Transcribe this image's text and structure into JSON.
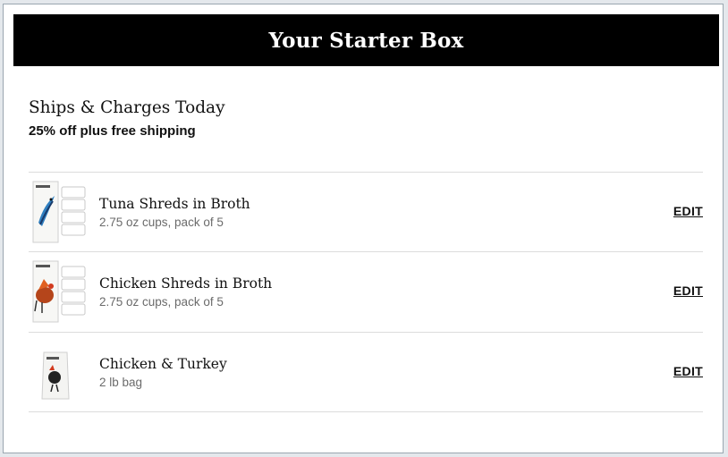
{
  "header": {
    "title": "Your Starter Box"
  },
  "section": {
    "title": "Ships & Charges Today",
    "subtitle": "25% off plus free shipping"
  },
  "items": [
    {
      "name": "Tuna Shreds in Broth",
      "desc": "2.75 oz cups, pack of 5",
      "edit_label": "EDIT",
      "image": "tuna-product-icon",
      "accent": "#2f7fc0"
    },
    {
      "name": "Chicken Shreds in Broth",
      "desc": "2.75 oz cups, pack of 5",
      "edit_label": "EDIT",
      "image": "chicken-product-icon",
      "accent": "#b5451b"
    },
    {
      "name": "Chicken & Turkey",
      "desc": "2 lb bag",
      "edit_label": "EDIT",
      "image": "kibble-bag-icon",
      "accent": "#222222"
    }
  ],
  "colors": {
    "header_bg": "#000000",
    "header_text": "#ffffff",
    "divider": "#dcdcdc",
    "muted_text": "#6b6b6b"
  }
}
